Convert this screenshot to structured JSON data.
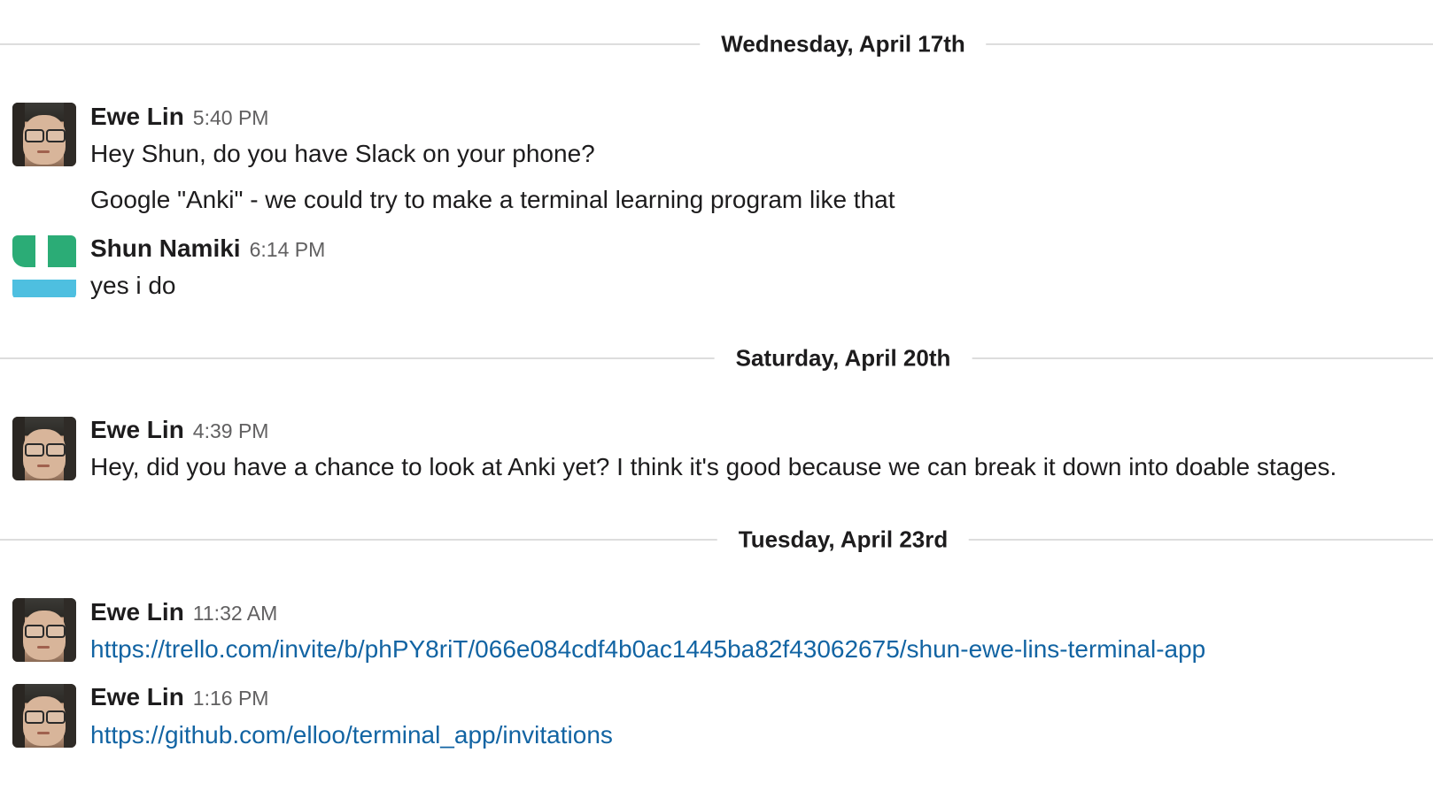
{
  "days": [
    {
      "label": "Wednesday, April 17th"
    },
    {
      "label": "Saturday, April 20th"
    },
    {
      "label": "Tuesday, April 23rd"
    }
  ],
  "messages": [
    {
      "author": "Ewe Lin",
      "time": "5:40 PM",
      "avatar": "photo",
      "lines": [
        "Hey Shun, do you have Slack on your phone?",
        "Google \"Anki\" - we could try to make a terminal learning program like that"
      ]
    },
    {
      "author": "Shun Namiki",
      "time": "6:14 PM",
      "avatar": "default",
      "lines": [
        "yes i do"
      ]
    },
    {
      "author": "Ewe Lin",
      "time": "4:39 PM",
      "avatar": "photo",
      "lines": [
        "Hey, did you have a chance to look at Anki yet? I think it's good because we can break it down into doable stages."
      ]
    },
    {
      "author": "Ewe Lin",
      "time": "11:32 AM",
      "avatar": "photo",
      "link": "https://trello.com/invite/b/phPY8riT/066e084cdf4b0ac1445ba82f43062675/shun-ewe-lins-terminal-app"
    },
    {
      "author": "Ewe Lin",
      "time": "1:16 PM",
      "avatar": "photo",
      "link": "https://github.com/elloo/terminal_app/invitations"
    }
  ],
  "colors": {
    "link": "#1264a3",
    "timestamp": "#616061",
    "divider": "#dddddd",
    "avatar_green": "#2bac76",
    "avatar_blue": "#4ebfe0"
  }
}
